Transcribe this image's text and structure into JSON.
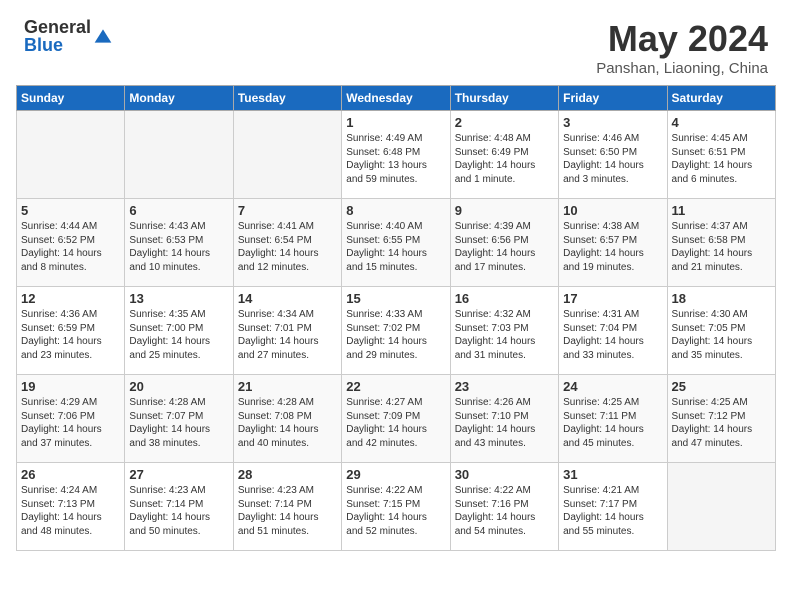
{
  "header": {
    "logo_general": "General",
    "logo_blue": "Blue",
    "month_title": "May 2024",
    "location": "Panshan, Liaoning, China"
  },
  "weekdays": [
    "Sunday",
    "Monday",
    "Tuesday",
    "Wednesday",
    "Thursday",
    "Friday",
    "Saturday"
  ],
  "weeks": [
    [
      {
        "day": "",
        "info": ""
      },
      {
        "day": "",
        "info": ""
      },
      {
        "day": "",
        "info": ""
      },
      {
        "day": "1",
        "info": "Sunrise: 4:49 AM\nSunset: 6:48 PM\nDaylight: 13 hours\nand 59 minutes."
      },
      {
        "day": "2",
        "info": "Sunrise: 4:48 AM\nSunset: 6:49 PM\nDaylight: 14 hours\nand 1 minute."
      },
      {
        "day": "3",
        "info": "Sunrise: 4:46 AM\nSunset: 6:50 PM\nDaylight: 14 hours\nand 3 minutes."
      },
      {
        "day": "4",
        "info": "Sunrise: 4:45 AM\nSunset: 6:51 PM\nDaylight: 14 hours\nand 6 minutes."
      }
    ],
    [
      {
        "day": "5",
        "info": "Sunrise: 4:44 AM\nSunset: 6:52 PM\nDaylight: 14 hours\nand 8 minutes."
      },
      {
        "day": "6",
        "info": "Sunrise: 4:43 AM\nSunset: 6:53 PM\nDaylight: 14 hours\nand 10 minutes."
      },
      {
        "day": "7",
        "info": "Sunrise: 4:41 AM\nSunset: 6:54 PM\nDaylight: 14 hours\nand 12 minutes."
      },
      {
        "day": "8",
        "info": "Sunrise: 4:40 AM\nSunset: 6:55 PM\nDaylight: 14 hours\nand 15 minutes."
      },
      {
        "day": "9",
        "info": "Sunrise: 4:39 AM\nSunset: 6:56 PM\nDaylight: 14 hours\nand 17 minutes."
      },
      {
        "day": "10",
        "info": "Sunrise: 4:38 AM\nSunset: 6:57 PM\nDaylight: 14 hours\nand 19 minutes."
      },
      {
        "day": "11",
        "info": "Sunrise: 4:37 AM\nSunset: 6:58 PM\nDaylight: 14 hours\nand 21 minutes."
      }
    ],
    [
      {
        "day": "12",
        "info": "Sunrise: 4:36 AM\nSunset: 6:59 PM\nDaylight: 14 hours\nand 23 minutes."
      },
      {
        "day": "13",
        "info": "Sunrise: 4:35 AM\nSunset: 7:00 PM\nDaylight: 14 hours\nand 25 minutes."
      },
      {
        "day": "14",
        "info": "Sunrise: 4:34 AM\nSunset: 7:01 PM\nDaylight: 14 hours\nand 27 minutes."
      },
      {
        "day": "15",
        "info": "Sunrise: 4:33 AM\nSunset: 7:02 PM\nDaylight: 14 hours\nand 29 minutes."
      },
      {
        "day": "16",
        "info": "Sunrise: 4:32 AM\nSunset: 7:03 PM\nDaylight: 14 hours\nand 31 minutes."
      },
      {
        "day": "17",
        "info": "Sunrise: 4:31 AM\nSunset: 7:04 PM\nDaylight: 14 hours\nand 33 minutes."
      },
      {
        "day": "18",
        "info": "Sunrise: 4:30 AM\nSunset: 7:05 PM\nDaylight: 14 hours\nand 35 minutes."
      }
    ],
    [
      {
        "day": "19",
        "info": "Sunrise: 4:29 AM\nSunset: 7:06 PM\nDaylight: 14 hours\nand 37 minutes."
      },
      {
        "day": "20",
        "info": "Sunrise: 4:28 AM\nSunset: 7:07 PM\nDaylight: 14 hours\nand 38 minutes."
      },
      {
        "day": "21",
        "info": "Sunrise: 4:28 AM\nSunset: 7:08 PM\nDaylight: 14 hours\nand 40 minutes."
      },
      {
        "day": "22",
        "info": "Sunrise: 4:27 AM\nSunset: 7:09 PM\nDaylight: 14 hours\nand 42 minutes."
      },
      {
        "day": "23",
        "info": "Sunrise: 4:26 AM\nSunset: 7:10 PM\nDaylight: 14 hours\nand 43 minutes."
      },
      {
        "day": "24",
        "info": "Sunrise: 4:25 AM\nSunset: 7:11 PM\nDaylight: 14 hours\nand 45 minutes."
      },
      {
        "day": "25",
        "info": "Sunrise: 4:25 AM\nSunset: 7:12 PM\nDaylight: 14 hours\nand 47 minutes."
      }
    ],
    [
      {
        "day": "26",
        "info": "Sunrise: 4:24 AM\nSunset: 7:13 PM\nDaylight: 14 hours\nand 48 minutes."
      },
      {
        "day": "27",
        "info": "Sunrise: 4:23 AM\nSunset: 7:14 PM\nDaylight: 14 hours\nand 50 minutes."
      },
      {
        "day": "28",
        "info": "Sunrise: 4:23 AM\nSunset: 7:14 PM\nDaylight: 14 hours\nand 51 minutes."
      },
      {
        "day": "29",
        "info": "Sunrise: 4:22 AM\nSunset: 7:15 PM\nDaylight: 14 hours\nand 52 minutes."
      },
      {
        "day": "30",
        "info": "Sunrise: 4:22 AM\nSunset: 7:16 PM\nDaylight: 14 hours\nand 54 minutes."
      },
      {
        "day": "31",
        "info": "Sunrise: 4:21 AM\nSunset: 7:17 PM\nDaylight: 14 hours\nand 55 minutes."
      },
      {
        "day": "",
        "info": ""
      }
    ]
  ]
}
